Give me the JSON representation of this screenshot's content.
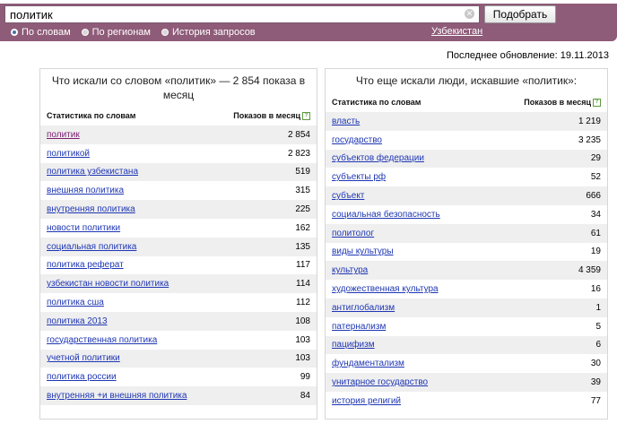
{
  "search": {
    "value": "политик",
    "clear_icon": "clear-icon",
    "submit_label": "Подобрать"
  },
  "modes": [
    {
      "label": "По словам",
      "selected": true
    },
    {
      "label": "По регионам",
      "selected": false
    },
    {
      "label": "История запросов",
      "selected": false
    }
  ],
  "region": "Узбекистан",
  "updated": "Последнее обновление: 19.11.2013",
  "left": {
    "title": "Что искали со словом «политик» — 2 854 показа в месяц",
    "col_words": "Статистика по словам",
    "col_shows": "Показов в месяц",
    "help_icon": "?",
    "rows": [
      {
        "phrase": "политик",
        "count": "2 854"
      },
      {
        "phrase": "политикой",
        "count": "2 823"
      },
      {
        "phrase": "политика узбекистана",
        "count": "519"
      },
      {
        "phrase": "внешняя политика",
        "count": "315"
      },
      {
        "phrase": "внутренняя политика",
        "count": "225"
      },
      {
        "phrase": "новости политики",
        "count": "162"
      },
      {
        "phrase": "социальная политика",
        "count": "135"
      },
      {
        "phrase": "политика реферат",
        "count": "117"
      },
      {
        "phrase": "узбекистан новости политика",
        "count": "114"
      },
      {
        "phrase": "политика сша",
        "count": "112"
      },
      {
        "phrase": "политика 2013",
        "count": "108"
      },
      {
        "phrase": "государственная политика",
        "count": "103"
      },
      {
        "phrase": "учетной политики",
        "count": "103"
      },
      {
        "phrase": "политика россии",
        "count": "99"
      },
      {
        "phrase": "внутренняя +и внешняя политика",
        "count": "84"
      },
      {
        "phrase": "",
        "count": ""
      }
    ]
  },
  "right": {
    "title": "Что еще искали люди, искавшие «политик»:",
    "col_words": "Статистика по словам",
    "col_shows": "Показов в месяц",
    "help_icon": "?",
    "rows": [
      {
        "phrase": "власть",
        "count": "1 219"
      },
      {
        "phrase": "государство",
        "count": "3 235"
      },
      {
        "phrase": "субъектов федерации",
        "count": "29"
      },
      {
        "phrase": "субъекты рф",
        "count": "52"
      },
      {
        "phrase": "субъект",
        "count": "666"
      },
      {
        "phrase": "социальная безопасность",
        "count": "34"
      },
      {
        "phrase": "политолог",
        "count": "61"
      },
      {
        "phrase": "виды культуры",
        "count": "19"
      },
      {
        "phrase": "культура",
        "count": "4 359"
      },
      {
        "phrase": "художественная культура",
        "count": "16"
      },
      {
        "phrase": "антиглобализм",
        "count": "1"
      },
      {
        "phrase": "патернализм",
        "count": "5"
      },
      {
        "phrase": "пацифизм",
        "count": "6"
      },
      {
        "phrase": "фундаментализм",
        "count": "30"
      },
      {
        "phrase": "унитарное государство",
        "count": "39"
      },
      {
        "phrase": "история религий",
        "count": "77"
      }
    ]
  }
}
